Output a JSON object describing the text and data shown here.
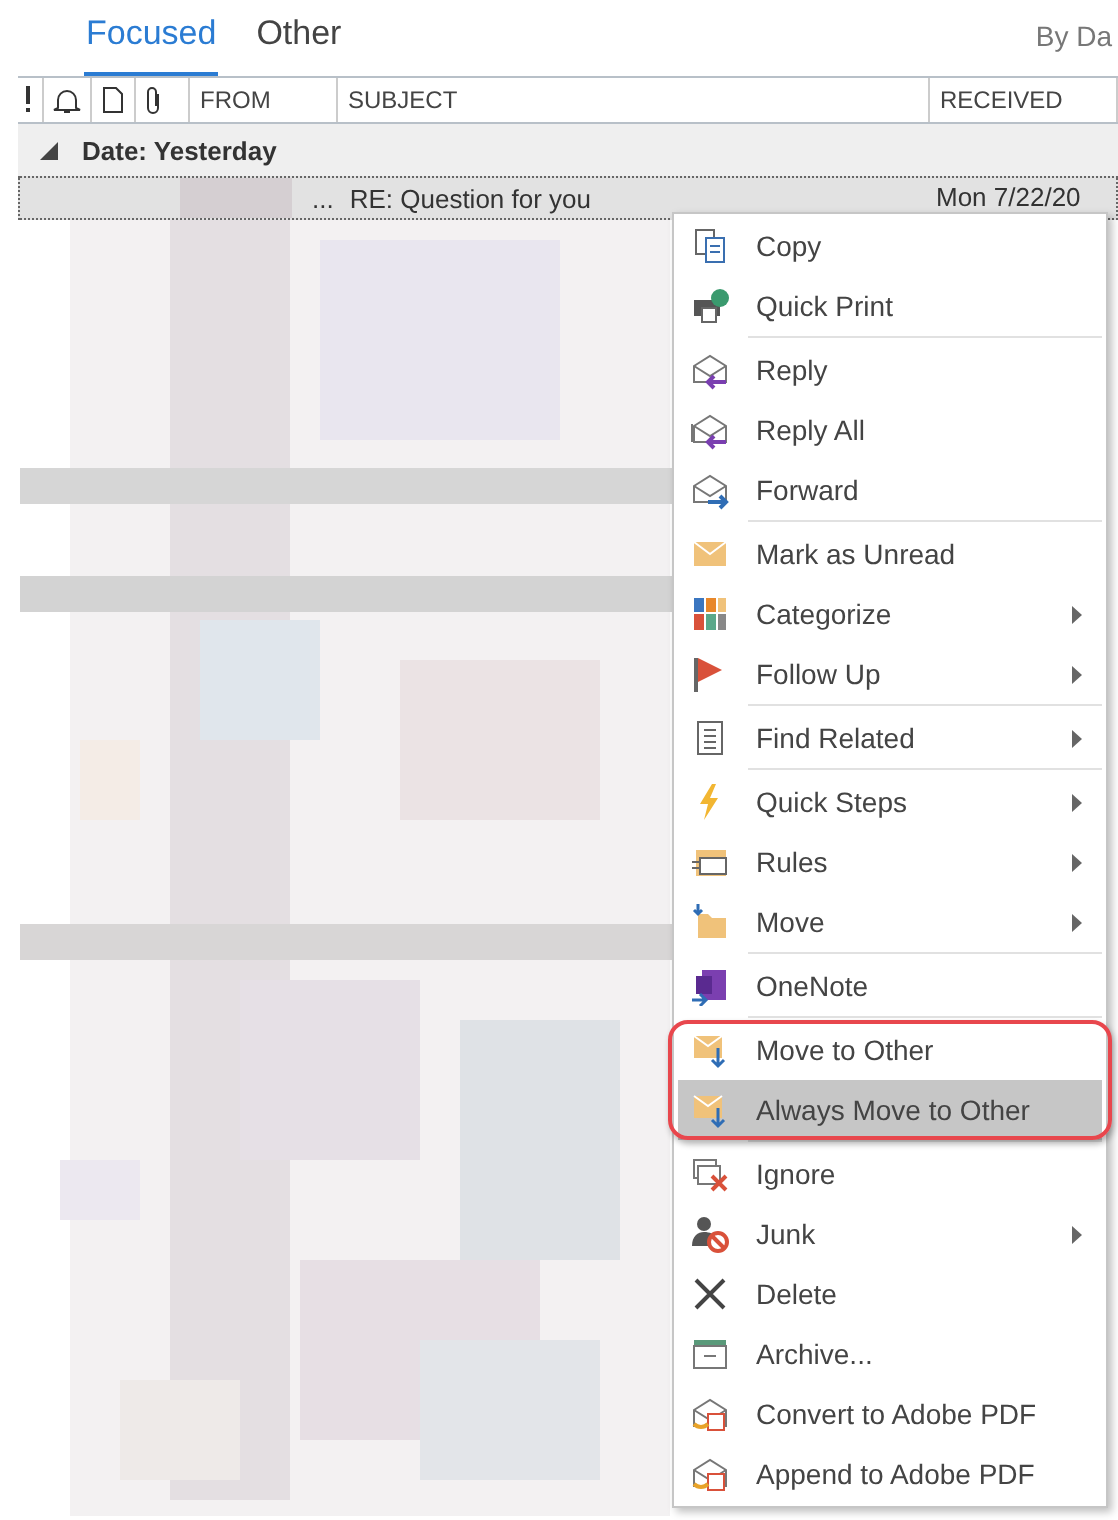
{
  "tabs": [
    {
      "label": "Focused",
      "selected": true
    },
    {
      "label": "Other",
      "selected": false
    }
  ],
  "sort_label": "By Da",
  "columns": [
    "FROM",
    "SUBJECT",
    "RECEIVED"
  ],
  "group": {
    "label": "Date: Yesterday",
    "expanded": true
  },
  "message": {
    "ellipsis": "...",
    "subject": "RE: Question for you",
    "received": "Mon 7/22/20",
    "selected": true
  },
  "context_menu": {
    "sections": [
      {
        "items": [
          {
            "label": "Copy",
            "submenu": false,
            "selected": false
          },
          {
            "label": "Quick Print",
            "submenu": false,
            "selected": false
          }
        ]
      },
      {
        "items": [
          {
            "label": "Reply",
            "submenu": false,
            "selected": false
          },
          {
            "label": "Reply All",
            "submenu": false,
            "selected": false
          },
          {
            "label": "Forward",
            "submenu": false,
            "selected": false
          }
        ]
      },
      {
        "items": [
          {
            "label": "Mark as Unread",
            "submenu": false,
            "selected": false
          },
          {
            "label": "Categorize",
            "submenu": true,
            "selected": false
          },
          {
            "label": "Follow Up",
            "submenu": true,
            "selected": false
          }
        ]
      },
      {
        "items": [
          {
            "label": "Find Related",
            "submenu": true,
            "selected": false
          }
        ]
      },
      {
        "items": [
          {
            "label": "Quick Steps",
            "submenu": true,
            "selected": false
          },
          {
            "label": "Rules",
            "submenu": true,
            "selected": false
          },
          {
            "label": "Move",
            "submenu": true,
            "selected": false
          }
        ]
      },
      {
        "items": [
          {
            "label": "OneNote",
            "submenu": false,
            "selected": false
          }
        ]
      },
      {
        "outlined": true,
        "items": [
          {
            "label": "Move to Other",
            "submenu": false,
            "selected": false
          },
          {
            "label": "Always Move to Other",
            "submenu": false,
            "selected": true
          }
        ]
      },
      {
        "items": [
          {
            "label": "Ignore",
            "submenu": false,
            "selected": false
          },
          {
            "label": "Junk",
            "submenu": true,
            "selected": false
          },
          {
            "label": "Delete",
            "submenu": false,
            "selected": false
          },
          {
            "label": "Archive...",
            "submenu": false,
            "selected": false
          },
          {
            "label": "Convert to Adobe PDF",
            "submenu": false,
            "selected": false
          },
          {
            "label": "Append to Adobe PDF",
            "submenu": false,
            "selected": false
          }
        ]
      }
    ]
  }
}
